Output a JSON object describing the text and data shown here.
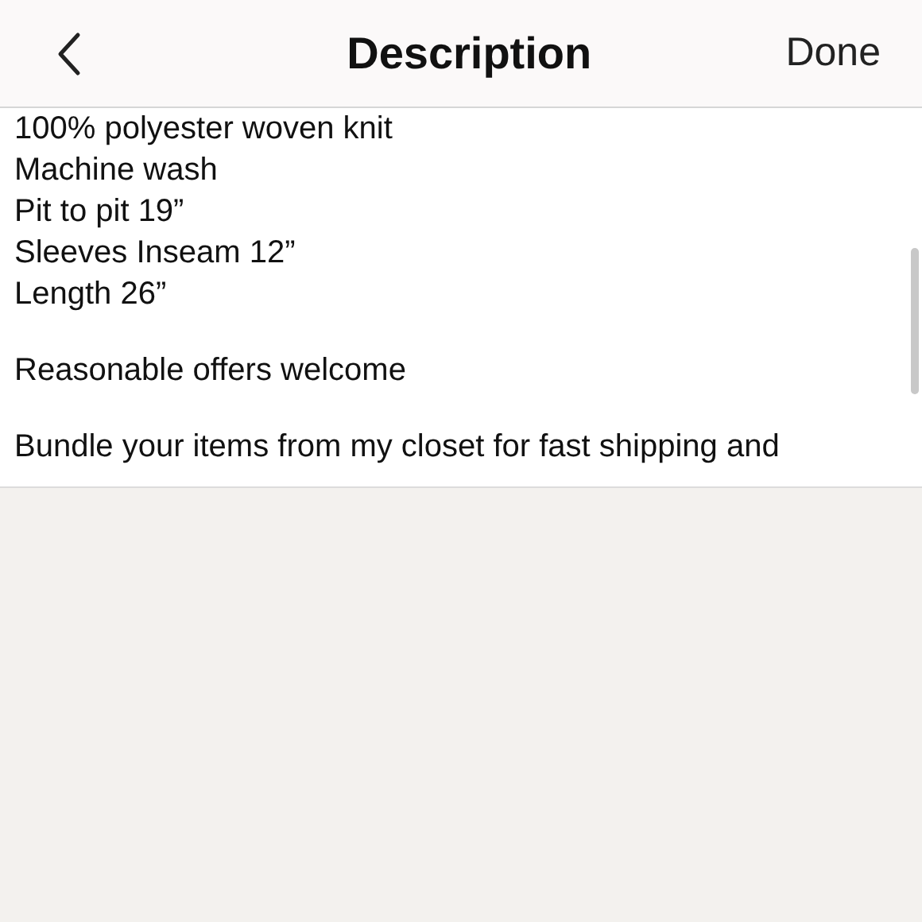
{
  "header": {
    "title": "Description",
    "done": "Done"
  },
  "paragraphs": [
    [
      "100% polyester woven knit",
      "Machine wash",
      "Pit to pit 19”",
      "Sleeves Inseam 12”",
      "Length 26”"
    ],
    [
      "Reasonable offers welcome"
    ],
    [
      "Bundle your items from my closet for fast shipping and"
    ]
  ]
}
